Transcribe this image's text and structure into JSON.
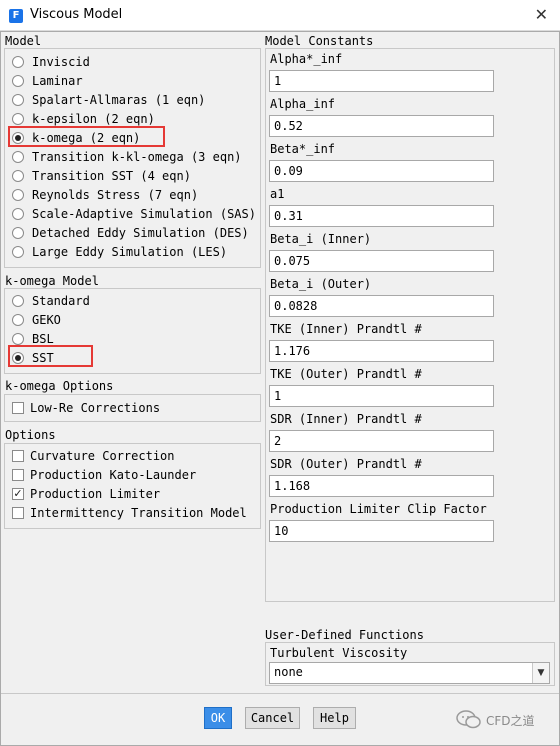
{
  "window": {
    "app_icon": "F",
    "title": "Viscous Model",
    "close": "✕"
  },
  "model": {
    "label": "Model",
    "options": [
      {
        "label": "Inviscid",
        "selected": false
      },
      {
        "label": "Laminar",
        "selected": false
      },
      {
        "label": "Spalart-Allmaras (1 eqn)",
        "selected": false
      },
      {
        "label": "k-epsilon (2 eqn)",
        "selected": false
      },
      {
        "label": "k-omega (2 eqn)",
        "selected": true
      },
      {
        "label": "Transition k-kl-omega (3 eqn)",
        "selected": false
      },
      {
        "label": "Transition SST (4 eqn)",
        "selected": false
      },
      {
        "label": "Reynolds Stress (7 eqn)",
        "selected": false
      },
      {
        "label": "Scale-Adaptive Simulation (SAS)",
        "selected": false
      },
      {
        "label": "Detached Eddy Simulation (DES)",
        "selected": false
      },
      {
        "label": "Large Eddy Simulation (LES)",
        "selected": false
      }
    ]
  },
  "komega_model": {
    "label": "k-omega Model",
    "options": [
      {
        "label": "Standard",
        "selected": false
      },
      {
        "label": "GEKO",
        "selected": false
      },
      {
        "label": "BSL",
        "selected": false
      },
      {
        "label": "SST",
        "selected": true
      }
    ]
  },
  "komega_options": {
    "label": "k-omega Options",
    "items": [
      {
        "label": "Low-Re Corrections",
        "checked": false
      }
    ]
  },
  "options": {
    "label": "Options",
    "items": [
      {
        "label": "Curvature Correction",
        "checked": false
      },
      {
        "label": "Production Kato-Launder",
        "checked": false
      },
      {
        "label": "Production Limiter",
        "checked": true
      },
      {
        "label": "Intermittency Transition Model",
        "checked": false
      }
    ]
  },
  "constants": {
    "label": "Model Constants",
    "fields": [
      {
        "label": "Alpha*_inf",
        "value": "1"
      },
      {
        "label": "Alpha_inf",
        "value": "0.52"
      },
      {
        "label": "Beta*_inf",
        "value": "0.09"
      },
      {
        "label": "a1",
        "value": "0.31"
      },
      {
        "label": "Beta_i (Inner)",
        "value": "0.075"
      },
      {
        "label": "Beta_i (Outer)",
        "value": "0.0828"
      },
      {
        "label": "TKE (Inner) Prandtl #",
        "value": "1.176"
      },
      {
        "label": "TKE (Outer) Prandtl #",
        "value": "1"
      },
      {
        "label": "SDR (Inner) Prandtl #",
        "value": "2"
      },
      {
        "label": "SDR (Outer) Prandtl #",
        "value": "1.168"
      },
      {
        "label": "Production Limiter Clip Factor",
        "value": "10"
      }
    ]
  },
  "udf": {
    "label": "User-Defined Functions",
    "turb_label": "Turbulent Viscosity",
    "turb_value": "none"
  },
  "buttons": {
    "ok": "OK",
    "cancel": "Cancel",
    "help": "Help"
  },
  "watermark": "CFD之道",
  "colors": {
    "highlight": "#e53935",
    "ok_button": "#3b8ee8"
  }
}
